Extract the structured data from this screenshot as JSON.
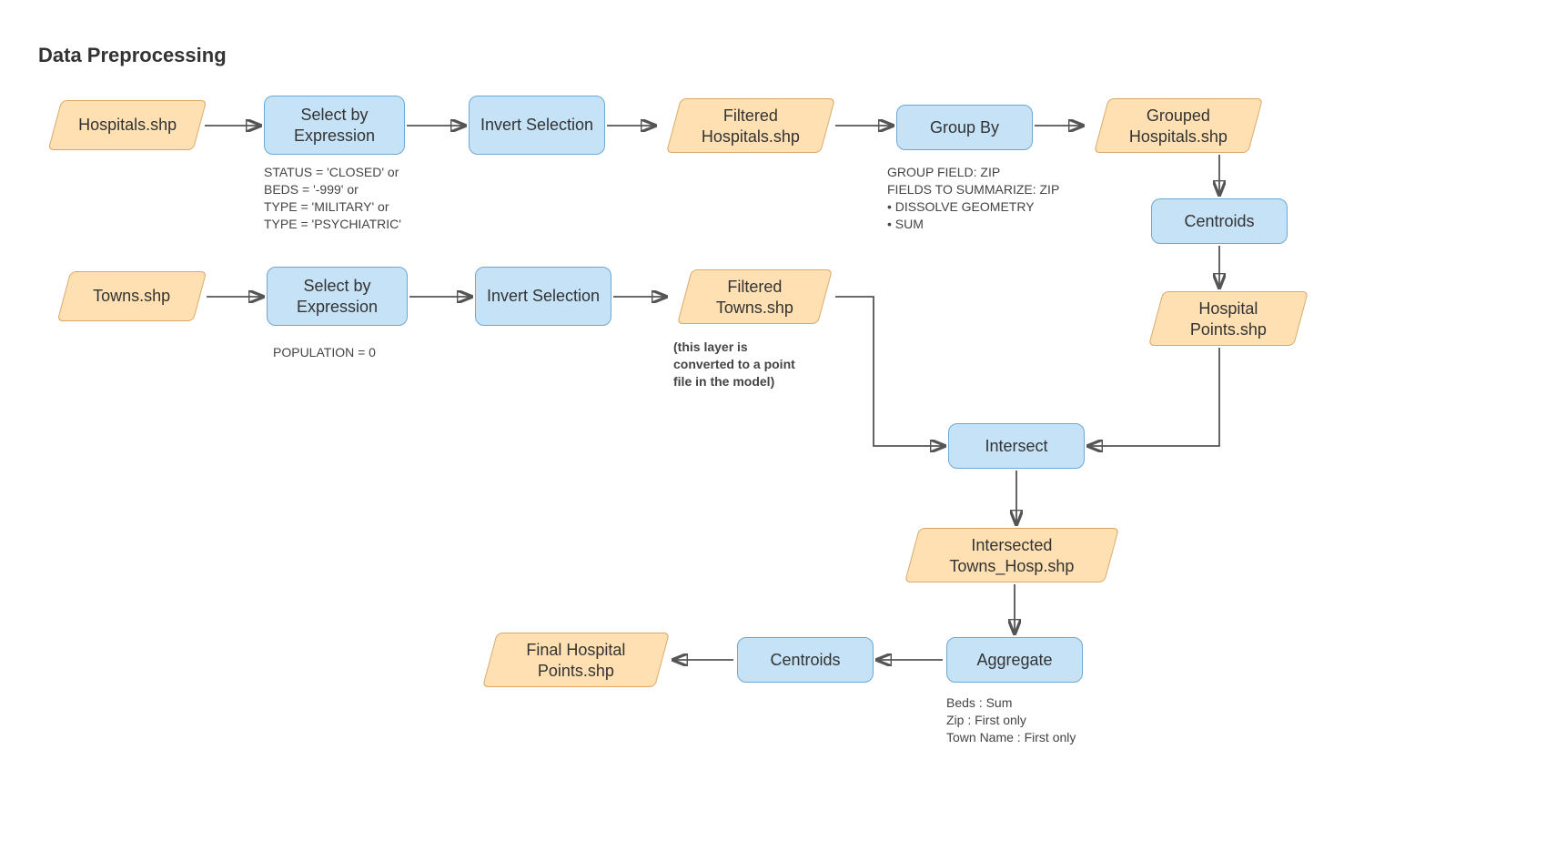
{
  "title": "Data Preprocessing",
  "row1": {
    "hospitals_shp": "Hospitals.shp",
    "select_by_expression": "Select by\nExpression",
    "select_caption": "STATUS = 'CLOSED' or\nBEDS = '-999' or\nTYPE = 'MILITARY' or\nTYPE = 'PSYCHIATRIC'",
    "invert_selection": "Invert\nSelection",
    "filtered_hospitals": "Filtered\nHospitals.shp",
    "group_by": "Group By",
    "group_caption": "GROUP FIELD: ZIP\nFIELDS TO SUMMARIZE: ZIP\n• DISSOLVE GEOMETRY\n• SUM",
    "grouped_hospitals": "Grouped\nHospitals.shp"
  },
  "rightcol": {
    "centroids": "Centroids",
    "hospital_points": "Hospital\nPoints.shp"
  },
  "row2": {
    "towns_shp": "Towns.shp",
    "select_by_expression": "Select by\nExpression",
    "select_caption": "POPULATION = 0",
    "invert_selection": "Invert\nSelection",
    "filtered_towns": "Filtered\nTowns.shp",
    "filtered_towns_caption": "(this layer is\nconverted to a point\nfile in the model)"
  },
  "mid": {
    "intersect": "Intersect",
    "intersected": "Intersected\nTowns_Hosp.shp"
  },
  "bottom": {
    "aggregate": "Aggregate",
    "aggregate_caption": "Beds : Sum\nZip : First only\nTown Name : First only",
    "centroids": "Centroids",
    "final": "Final Hospital\nPoints.shp"
  },
  "colors": {
    "process_fill": "#c6e2f7",
    "process_border": "#6ea7d2",
    "data_fill": "#ffe0b2",
    "data_border": "#d9a96a",
    "arrow": "#555555"
  }
}
